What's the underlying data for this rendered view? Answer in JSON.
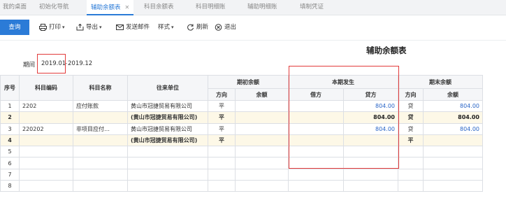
{
  "tabs": [
    {
      "label": "我的桌面"
    },
    {
      "label": "初始化导航"
    },
    {
      "label": "辅助余额表",
      "close": "✕"
    },
    {
      "label": "科目余额表"
    },
    {
      "label": "科目明细账"
    },
    {
      "label": "辅助明细账"
    },
    {
      "label": "填制凭证"
    }
  ],
  "toolbar": {
    "query": "查询",
    "print": "打印",
    "export": "导出",
    "send_email": "发送邮件",
    "style": "样式",
    "refresh": "刷新",
    "exit": "退出"
  },
  "icons": [
    "printer-icon",
    "export-icon",
    "mail-icon",
    "refresh-icon",
    "exit-icon"
  ],
  "report": {
    "title": "辅助余额表",
    "period_label": "期间",
    "period_start": "2019.01",
    "period_separator": "-",
    "period_end": "2019.12"
  },
  "table": {
    "headers": {
      "seq": "序号",
      "account_code": "科目编码",
      "account_name": "科目名称",
      "counterparty": "往来单位",
      "opening": "期初余额",
      "current": "本期发生",
      "closing": "期末余额",
      "direction": "方向",
      "balance": "余额",
      "debit": "借方",
      "credit": "贷方"
    },
    "rows": [
      {
        "seq": "1",
        "code": "2202",
        "name": "应付账款",
        "unit": "黄山市冠捷贸易有限公司",
        "open_dir": "平",
        "open_bal": "",
        "debit": "",
        "credit": "804.00",
        "close_dir": "贷",
        "close_bal": "804.00"
      },
      {
        "seq": "2",
        "code": "",
        "name": "",
        "unit": "(黄山市冠捷贸易有限公司)",
        "open_dir": "平",
        "open_bal": "",
        "debit": "",
        "credit": "804.00",
        "close_dir": "贷",
        "close_bal": "804.00"
      },
      {
        "seq": "3",
        "code": "220202",
        "name": "非项目应付…",
        "unit": "黄山市冠捷贸易有限公司",
        "open_dir": "平",
        "open_bal": "",
        "debit": "",
        "credit": "804.00",
        "close_dir": "贷",
        "close_bal": "804.00"
      },
      {
        "seq": "4",
        "code": "",
        "name": "",
        "unit": "(黄山市冠捷贸易有限公司)",
        "open_dir": "平",
        "open_bal": "",
        "debit": "",
        "credit": "",
        "close_dir": "平",
        "close_bal": ""
      },
      {
        "seq": "5",
        "code": "",
        "name": "",
        "unit": "",
        "open_dir": "",
        "open_bal": "",
        "debit": "",
        "credit": "",
        "close_dir": "",
        "close_bal": ""
      },
      {
        "seq": "6",
        "code": "",
        "name": "",
        "unit": "",
        "open_dir": "",
        "open_bal": "",
        "debit": "",
        "credit": "",
        "close_dir": "",
        "close_bal": ""
      },
      {
        "seq": "7",
        "code": "",
        "name": "",
        "unit": "",
        "open_dir": "",
        "open_bal": "",
        "debit": "",
        "credit": "",
        "close_dir": "",
        "close_bal": ""
      },
      {
        "seq": "8",
        "code": "",
        "name": "",
        "unit": "",
        "open_dir": "",
        "open_bal": "",
        "debit": "",
        "credit": "",
        "close_dir": "",
        "close_bal": ""
      }
    ],
    "subtotal_rows": [
      1,
      3
    ]
  },
  "colors": {
    "accent": "#2b7bd7",
    "highlight_border": "#e23b3b",
    "subtotal_bg": "#fdf8e7",
    "value_blue": "#2b66c7"
  }
}
